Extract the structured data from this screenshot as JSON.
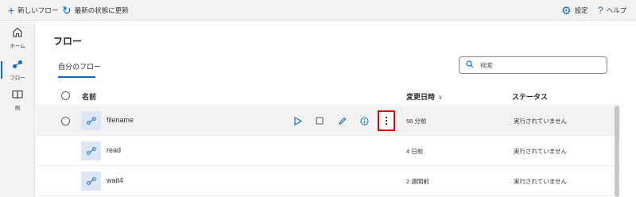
{
  "toolbar": {
    "new_flow_label": "新しいフロー",
    "refresh_label": "最新の状態に更新",
    "settings_label": "設定",
    "help_label": "ヘルプ"
  },
  "nav": {
    "items": [
      {
        "label": "ホーム",
        "icon": "home-icon"
      },
      {
        "label": "フロー",
        "icon": "flow-icon",
        "active": true
      },
      {
        "label": "例",
        "icon": "book-icon"
      }
    ]
  },
  "page": {
    "title": "フロー",
    "tab_label": "自分のフロー",
    "search_placeholder": "検索"
  },
  "table": {
    "headers": {
      "name": "名前",
      "modified": "変更日時",
      "status": "ステータス"
    },
    "rows": [
      {
        "name": "filename",
        "modified": "56 分前",
        "status": "実行されていません"
      },
      {
        "name": "read",
        "modified": "4 日前",
        "status": "実行されていません"
      },
      {
        "name": "wait4",
        "modified": "2 週間前",
        "status": "実行されていません"
      }
    ]
  },
  "colors": {
    "accent": "#0f6cbd",
    "highlight_box": "#e00000"
  }
}
